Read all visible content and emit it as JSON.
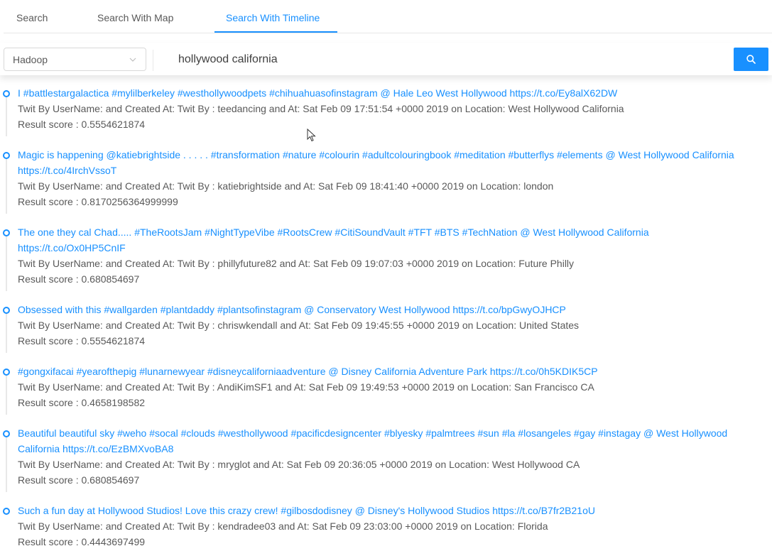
{
  "tabs": [
    {
      "label": "Search",
      "active": false
    },
    {
      "label": "Search With Map",
      "active": false
    },
    {
      "label": "Search With Timeline",
      "active": true
    }
  ],
  "search": {
    "engine": "Hadoop",
    "query": "hollywood california",
    "button_icon": "search-icon"
  },
  "colors": {
    "accent": "#1890ff",
    "text": "#595959",
    "border": "#d9d9d9"
  },
  "results": [
    {
      "text": "I #battlestargalactica #mylilberkeley #westhollywoodpets #chihuahuasofinstagram @ Hale Leo West Hollywood https://t.co/Ey8alX62DW",
      "meta": "Twit By UserName: and Created At: Twit By : teedancing and At: Sat Feb 09 17:51:54 +0000 2019 on Location: West Hollywood California",
      "score": "Result score : 0.5554621874"
    },
    {
      "text": "Magic is happening @katiebrightside . . . . . #transformation #nature #colourin #adultcolouringbook #meditation #butterflys #elements @ West Hollywood California https://t.co/4IrchVssoT",
      "meta": "Twit By UserName: and Created At: Twit By : katiebrightside and At: Sat Feb 09 18:41:40 +0000 2019 on Location: london",
      "score": "Result score : 0.8170256364999999"
    },
    {
      "text": "The one they cal Chad..... #TheRootsJam #NightTypeVibe #RootsCrew #CitiSoundVault #TFT #BTS #TechNation @ West Hollywood California https://t.co/Ox0HP5CnIF",
      "meta": "Twit By UserName: and Created At: Twit By : phillyfuture82 and At: Sat Feb 09 19:07:03 +0000 2019 on Location: Future Philly",
      "score": "Result score : 0.680854697"
    },
    {
      "text": "Obsessed with this #wallgarden #plantdaddy #plantsofinstagram @ Conservatory West Hollywood https://t.co/bpGwyOJHCP",
      "meta": "Twit By UserName: and Created At: Twit By : chriswkendall and At: Sat Feb 09 19:45:55 +0000 2019 on Location: United States",
      "score": "Result score : 0.5554621874"
    },
    {
      "text": "#gongxifacai #yearofthepig #lunarnewyear #disneycaliforniaadventure @ Disney California Adventure Park https://t.co/0h5KDIK5CP",
      "meta": "Twit By UserName: and Created At: Twit By : AndiKimSF1 and At: Sat Feb 09 19:49:53 +0000 2019 on Location: San Francisco CA",
      "score": "Result score : 0.4658198582"
    },
    {
      "text": "Beautiful beautiful sky #weho #socal #clouds #westhollywood #pacificdesigncenter #blyesky #palmtrees #sun #la #losangeles #gay #instagay @ West Hollywood California https://t.co/EzBMXvoBA8",
      "meta": "Twit By UserName: and Created At: Twit By : mryglot and At: Sat Feb 09 20:36:05 +0000 2019 on Location: West Hollywood CA",
      "score": "Result score : 0.680854697"
    },
    {
      "text": "Such a fun day at Hollywood Studios! Love this crazy crew! #gilbosdodisney @ Disney's Hollywood Studios https://t.co/B7fr2B21oU",
      "meta": "Twit By UserName: and Created At: Twit By : kendradee03 and At: Sat Feb 09 23:03:00 +0000 2019 on Location: Florida",
      "score": "Result score : 0.4443697499"
    }
  ]
}
